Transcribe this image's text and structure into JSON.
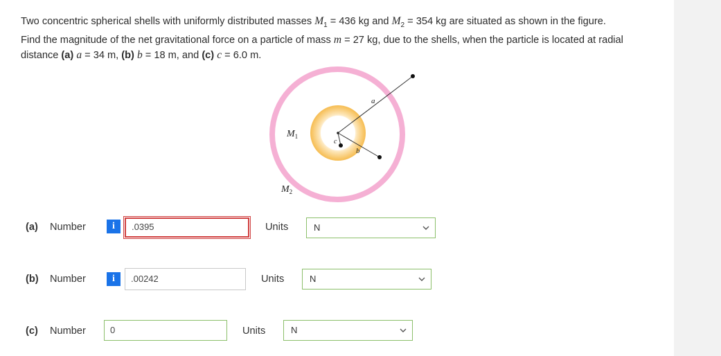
{
  "problem": {
    "line1_prefix": "Two concentric spherical shells with uniformly distributed masses ",
    "m1_symbol": "M",
    "m1_sub": "1",
    "m1_value": " = 436 kg and ",
    "m2_symbol": "M",
    "m2_sub": "2",
    "m2_value": " = 354 kg are situated as shown in the figure.",
    "line2": "Find the magnitude of the net gravitational force on a particle of mass ",
    "m_symbol": "m",
    "m_value": " = 27 kg, due to the shells, when the particle is located at radial",
    "line3_prefix": "distance ",
    "part_a": "(a)",
    "a_sym": "a",
    "a_val": " = 34 m, ",
    "part_b": "(b)",
    "b_sym": "b",
    "b_val": " = 18 m, and ",
    "part_c": "(c)",
    "c_sym": "c",
    "c_val": " = 6.0 m."
  },
  "figure": {
    "label_m1": "M",
    "label_m1_sub": "1",
    "label_m2": "M",
    "label_m2_sub": "2",
    "label_a": "a",
    "label_b": "b",
    "label_c": "c",
    "outer_shell_color": "#f4a6cf",
    "inner_shell_color": "#f6c15a"
  },
  "answers": [
    {
      "part": "(a)",
      "number_label": "Number",
      "info_icon": "i",
      "value": ".0395",
      "units_label": "Units",
      "unit": "N",
      "state": "error"
    },
    {
      "part": "(b)",
      "number_label": "Number",
      "info_icon": "i",
      "value": ".00242",
      "units_label": "Units",
      "unit": "N",
      "state": "neutral"
    },
    {
      "part": "(c)",
      "number_label": "Number",
      "info_icon": "",
      "value": "0",
      "units_label": "Units",
      "unit": "N",
      "state": "correct"
    }
  ]
}
